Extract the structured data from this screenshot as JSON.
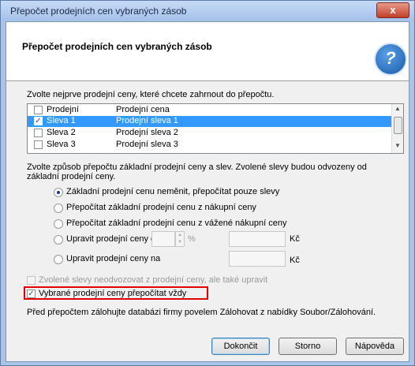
{
  "window": {
    "title": "Přepočet prodejních cen vybraných zásob",
    "close_label": "x"
  },
  "header": {
    "title": "Přepočet prodejních cen vybraných zásob",
    "logo_glyph": "?",
    "logo_icon": "help-circle-icon"
  },
  "instructions": {
    "select_prices": "Zvolte nejprve prodejní ceny, které chcete zahrnout do přepočtu.",
    "method_line1": "Zvolte způsob přepočtu základní prodejní ceny a slev. Zvolené slevy budou odvozeny od",
    "method_line2": "základní prodejní ceny."
  },
  "price_list": {
    "columns": [
      "Prodejní",
      "Prodejní cena"
    ],
    "rows": [
      {
        "code": "Sleva 1",
        "name": "Prodejní sleva 1",
        "checked": true,
        "selected": true
      },
      {
        "code": "Sleva 2",
        "name": "Prodejní sleva 2",
        "checked": false,
        "selected": false
      },
      {
        "code": "Sleva 3",
        "name": "Prodejní sleva 3",
        "checked": false,
        "selected": false
      }
    ]
  },
  "options": [
    {
      "label": "Základní prodejní cenu neměnit, přepočítat pouze slevy",
      "selected": true
    },
    {
      "label": "Přepočítat základní prodejní cenu z nákupní ceny",
      "selected": false
    },
    {
      "label": "Přepočítat základní prodejní cenu z vážené nákupní ceny",
      "selected": false
    },
    {
      "label": "Upravit prodejní ceny o",
      "selected": false
    },
    {
      "label": "Upravit prodejní ceny na",
      "selected": false
    }
  ],
  "adjust": {
    "percent_unit": "%",
    "currency_unit": "Kč",
    "currency_unit2": "Kč"
  },
  "checkboxes": {
    "dont_derive": "Zvolené slevy neodvozovat z prodejní ceny, ale také upravit",
    "always_recalc": "Vybrané prodejní ceny přepočítat vždy"
  },
  "backup_note": "Před přepočtem zálohujte databázi firmy povelem Zálohovat z nabídky Soubor/Zálohování.",
  "buttons": {
    "finish": "Dokončit",
    "cancel": "Storno",
    "help": "Nápověda"
  },
  "colors": {
    "selection": "#3399ff",
    "highlight_border": "#e00000"
  }
}
